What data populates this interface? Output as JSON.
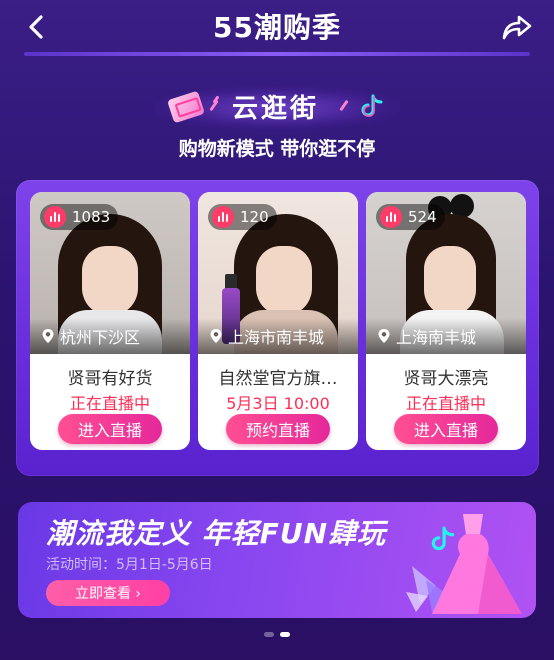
{
  "header": {
    "title": "55潮购季"
  },
  "hero": {
    "brand": "云逛街",
    "subtitle": "购物新模式 带你逛不停"
  },
  "cards": [
    {
      "viewers": "1083",
      "location": "杭州下沙区",
      "shop": "贤哥有好货",
      "status": "正在直播中",
      "button": "进入直播"
    },
    {
      "viewers": "120",
      "location": "上海市南丰城",
      "shop": "自然堂官方旗…",
      "status": "5月3日 10:00",
      "button": "预约直播"
    },
    {
      "viewers": "524",
      "location": "上海南丰城",
      "shop": "贤哥大漂亮",
      "status": "正在直播中",
      "button": "进入直播"
    }
  ],
  "promo": {
    "title": "潮流我定义 年轻FUN肆玩",
    "date": "活动时间：5月1日-5月6日",
    "button": "立即查看 ›"
  },
  "colors": {
    "accent": "#ff2e56",
    "button": "#ff4f93",
    "panel": "#6a2fdc"
  }
}
